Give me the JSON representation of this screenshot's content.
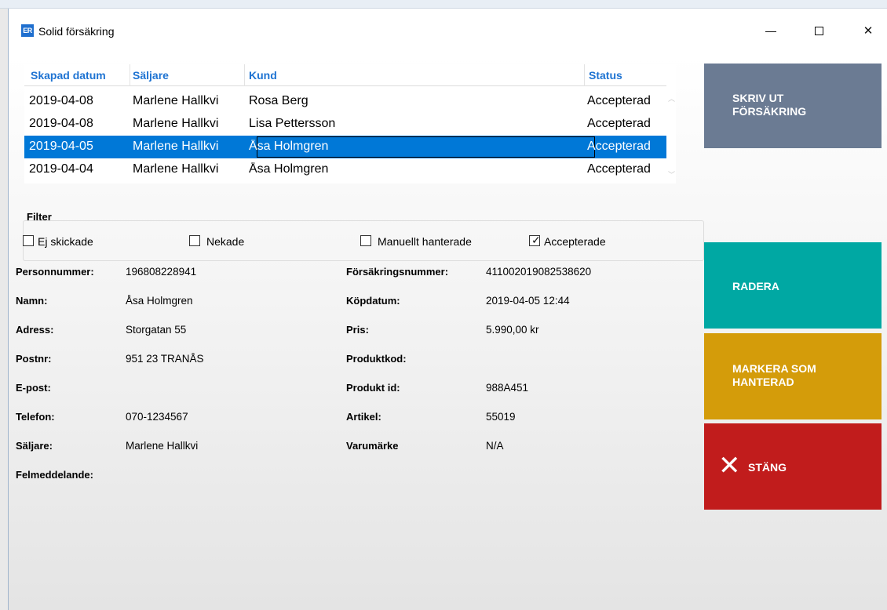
{
  "window": {
    "app_icon": "ER",
    "title": "Solid försäkring",
    "controls": {
      "minimize": "minimize-icon",
      "maximize": "maximize-icon",
      "close": "close-icon"
    }
  },
  "grid": {
    "columns": [
      "Skapad datum",
      "Säljare",
      "Kund",
      "Status"
    ],
    "rows": [
      {
        "date": "2019-04-08",
        "seller": "Marlene Hallkvi",
        "customer": "Rosa Berg",
        "status": "Accepterad",
        "selected": false
      },
      {
        "date": "2019-04-08",
        "seller": "Marlene Hallkvi",
        "customer": "Lisa Pettersson",
        "status": "Accepterad",
        "selected": false
      },
      {
        "date": "2019-04-05",
        "seller": "Marlene Hallkvi",
        "customer": "Åsa Holmgren",
        "status": "Accepterad",
        "selected": true
      },
      {
        "date": "2019-04-04",
        "seller": "Marlene Hallkvi",
        "customer": "Åsa Holmgren",
        "status": "Accepterad",
        "selected": false
      }
    ]
  },
  "filter": {
    "label": "Filter",
    "options": [
      {
        "label": "Ej skickade",
        "checked": false
      },
      {
        "label": "Nekade",
        "checked": false
      },
      {
        "label": "Manuellt hanterade",
        "checked": false
      },
      {
        "label": "Accepterade",
        "checked": true
      }
    ]
  },
  "details": {
    "left": [
      {
        "label": "Personnummer:",
        "value": "196808228941"
      },
      {
        "label": "Namn:",
        "value": "Åsa Holmgren"
      },
      {
        "label": "Adress:",
        "value": "Storgatan 55"
      },
      {
        "label": "Postnr:",
        "value": "951 23 TRANÅS"
      },
      {
        "label": "E-post:",
        "value": ""
      },
      {
        "label": "Telefon:",
        "value": "070-1234567"
      },
      {
        "label": "Säljare:",
        "value": "Marlene Hallkvi"
      },
      {
        "label": "Felmeddelande:",
        "value": ""
      }
    ],
    "right": [
      {
        "label": "Försäkringsnummer:",
        "value": "411002019082538620"
      },
      {
        "label": "Köpdatum:",
        "value": "2019-04-05 12:44"
      },
      {
        "label": "Pris:",
        "value": "5.990,00 kr"
      },
      {
        "label": "Produktkod:",
        "value": ""
      },
      {
        "label": "Produkt id:",
        "value": "988A451"
      },
      {
        "label": "Artikel:",
        "value": "55019"
      },
      {
        "label": "Varumärke",
        "value": "N/A"
      }
    ]
  },
  "actions": {
    "print_line1": "SKRIV UT",
    "print_line2": "FÖRSÄKRING",
    "delete": "RADERA",
    "mark_line1": "MARKERA SOM",
    "mark_line2": "HANTERAD",
    "close": "STÄNG",
    "close_icon": "x-icon"
  },
  "colors": {
    "print": "#6b7b93",
    "delete": "#00a8a3",
    "mark": "#d49c0a",
    "close": "#c11c1c",
    "selection": "#0078d7",
    "header_text": "#1e73d2"
  }
}
